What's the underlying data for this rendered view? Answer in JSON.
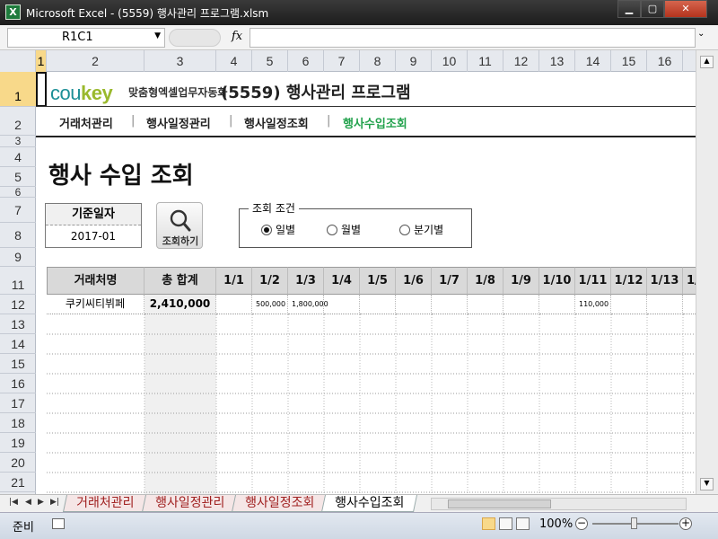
{
  "window": {
    "app_icon": "X",
    "title": "Microsoft Excel - (5559) 행사관리 프로그램.xlsm",
    "minimize_label": "▁",
    "maximize_label": "▢",
    "close_label": "✕"
  },
  "formula_bar": {
    "name_box": "R1C1",
    "fx_label": "fx",
    "formula": ""
  },
  "columns": [
    "1",
    "2",
    "3",
    "4",
    "5",
    "6",
    "7",
    "8",
    "9",
    "10",
    "11",
    "12",
    "13",
    "14",
    "15",
    "16"
  ],
  "rows": [
    "1",
    "2",
    "3",
    "4",
    "5",
    "6",
    "7",
    "8",
    "9",
    "10",
    "11",
    "12",
    "13",
    "14",
    "15",
    "16",
    "17",
    "18",
    "19",
    "20",
    "21"
  ],
  "header": {
    "logo_text_a": "cou",
    "logo_text_b": "key",
    "logo_sub": "맞춤형엑셀업무자동화",
    "app_title": "(5559) 행사관리 프로그램"
  },
  "nav": {
    "items": [
      "거래처관리",
      "행사일정관리",
      "행사일정조회",
      "행사수입조회"
    ],
    "separator": "|",
    "active_index": 3
  },
  "page": {
    "heading": "행사 수입 조회",
    "date_label": "기준일자",
    "date_value": "2017-01",
    "search_button": "조회하기",
    "conditions_label": "조회 조건",
    "options": [
      "일별",
      "월별",
      "분기별"
    ],
    "selected_option": "일별"
  },
  "table": {
    "headers": [
      "거래처명",
      "총 합계",
      "1/1",
      "1/2",
      "1/3",
      "1/4",
      "1/5",
      "1/6",
      "1/7",
      "1/8",
      "1/9",
      "1/10",
      "1/11",
      "1/12",
      "1/13",
      "1/"
    ],
    "rows": [
      [
        "쿠키씨티뷔페",
        "2,410,000",
        "",
        "500,000",
        "1,800,000",
        "",
        "",
        "",
        "",
        "",
        "",
        "",
        "110,000",
        "",
        "",
        ""
      ]
    ]
  },
  "sheet_tabs": {
    "tabs": [
      "거래처관리",
      "행사일정관리",
      "행사일정조회",
      "행사수입조회"
    ],
    "active": "행사수입조회"
  },
  "status": {
    "ready": "준비",
    "zoom": "100%",
    "zoom_value": 100,
    "zoom_out": "−",
    "zoom_in": "+"
  }
}
